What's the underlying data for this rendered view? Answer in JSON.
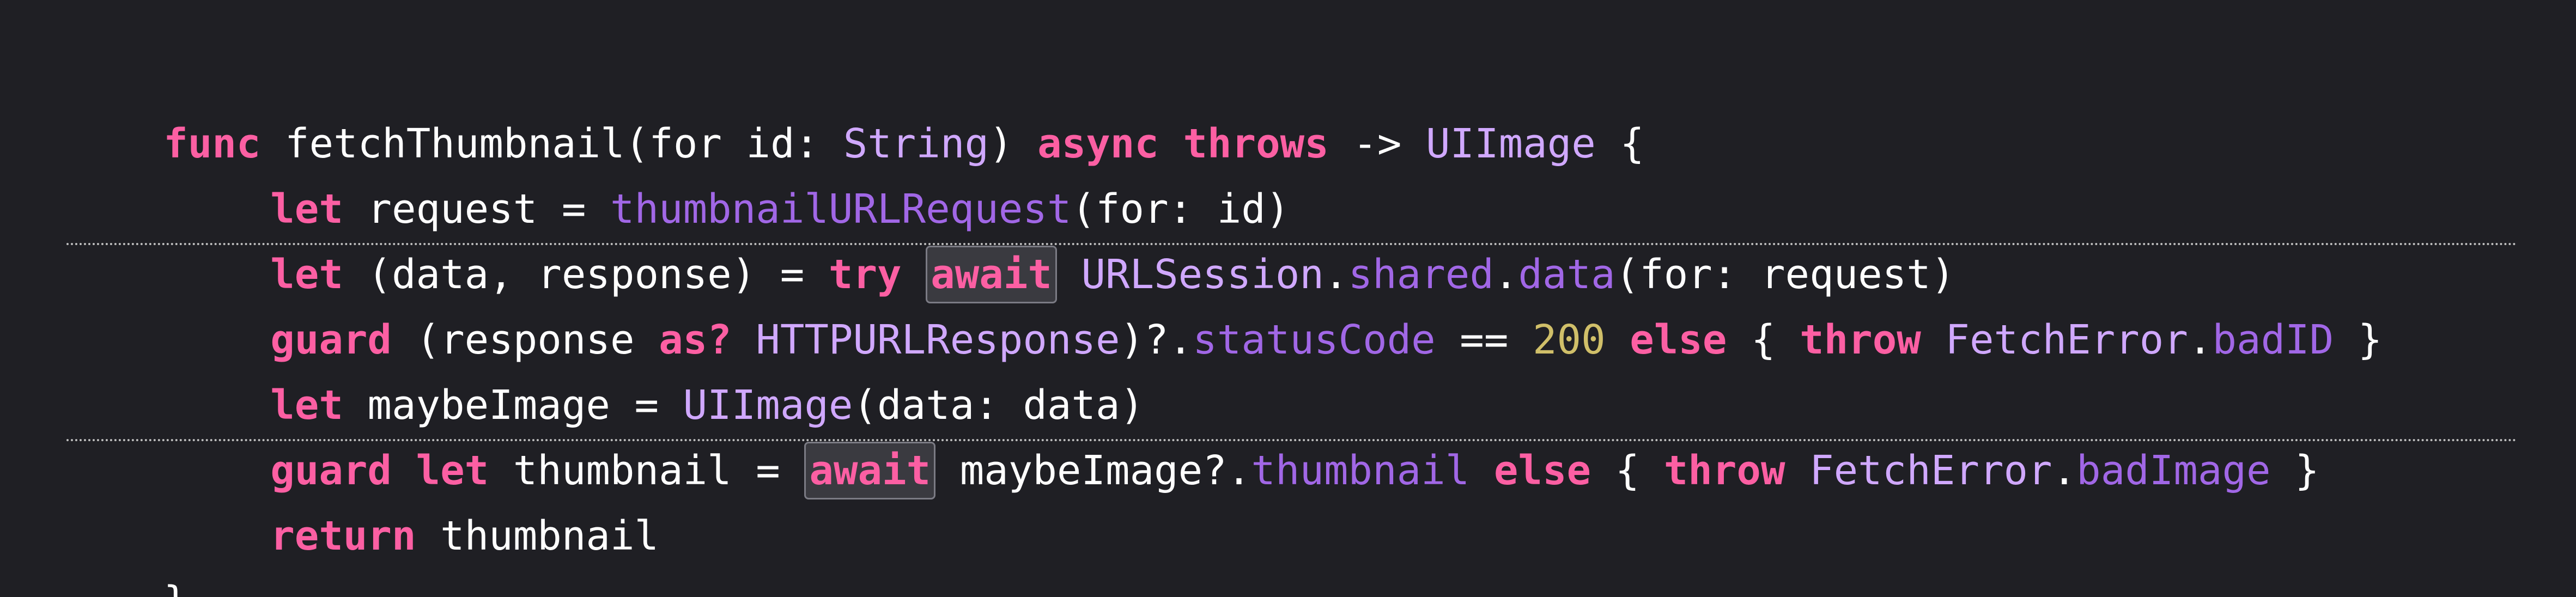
{
  "code": {
    "line1": {
      "kw_func": "func",
      "name": " fetchThumbnail(for id: ",
      "type_string": "String",
      "close_paren": ") ",
      "kw_async": "async",
      "space1": " ",
      "kw_throws": "throws",
      "arrow": " -> ",
      "type_uiimage": "UIImage",
      "brace_open": " {"
    },
    "line2": {
      "kw_let": "let",
      "text1": " request = ",
      "fn_call": "thumbnailURLRequest",
      "text2": "(for: id)"
    },
    "line3": {
      "kw_let": "let",
      "text1": " (data, response) = ",
      "kw_try": "try",
      "space": " ",
      "await_label": "await",
      "space2": " ",
      "type_urlsession": "URLSession",
      "dot1": ".",
      "prop_shared": "shared",
      "dot2": ".",
      "fn_data": "data",
      "text2": "(for: request)"
    },
    "line4": {
      "kw_guard": "guard",
      "text1": " (response ",
      "kw_as": "as?",
      "space": " ",
      "type_http": "HTTPURLResponse",
      "text2": ")?.",
      "prop_status": "statusCode",
      "text3": " == ",
      "num_200": "200",
      "space2": " ",
      "kw_else": "else",
      "text4": " { ",
      "kw_throw": "throw",
      "space3": " ",
      "type_fetcherror": "FetchError",
      "dot": ".",
      "prop_badid": "badID",
      "text5": " }"
    },
    "line5": {
      "kw_let": "let",
      "text1": " maybeImage = ",
      "type_uiimage": "UIImage",
      "text2": "(data: data)"
    },
    "line6": {
      "kw_guard": "guard",
      "space": " ",
      "kw_let": "let",
      "text1": " thumbnail = ",
      "await_label": "await",
      "text2": " maybeImage?.",
      "prop_thumbnail": "thumbnail",
      "space2": " ",
      "kw_else": "else",
      "text3": " { ",
      "kw_throw": "throw",
      "space3": " ",
      "type_fetcherror": "FetchError",
      "dot": ".",
      "prop_badimage": "badImage",
      "text4": " }"
    },
    "line7": {
      "kw_return": "return",
      "text1": " thumbnail"
    },
    "line8": {
      "brace_close": "}"
    }
  },
  "colors": {
    "background": "#1f1f24",
    "keyword": "#fc5fa3",
    "type": "#d0a8ff",
    "function": "#a167e6",
    "number": "#d0bf69",
    "plain": "#ffffff"
  }
}
